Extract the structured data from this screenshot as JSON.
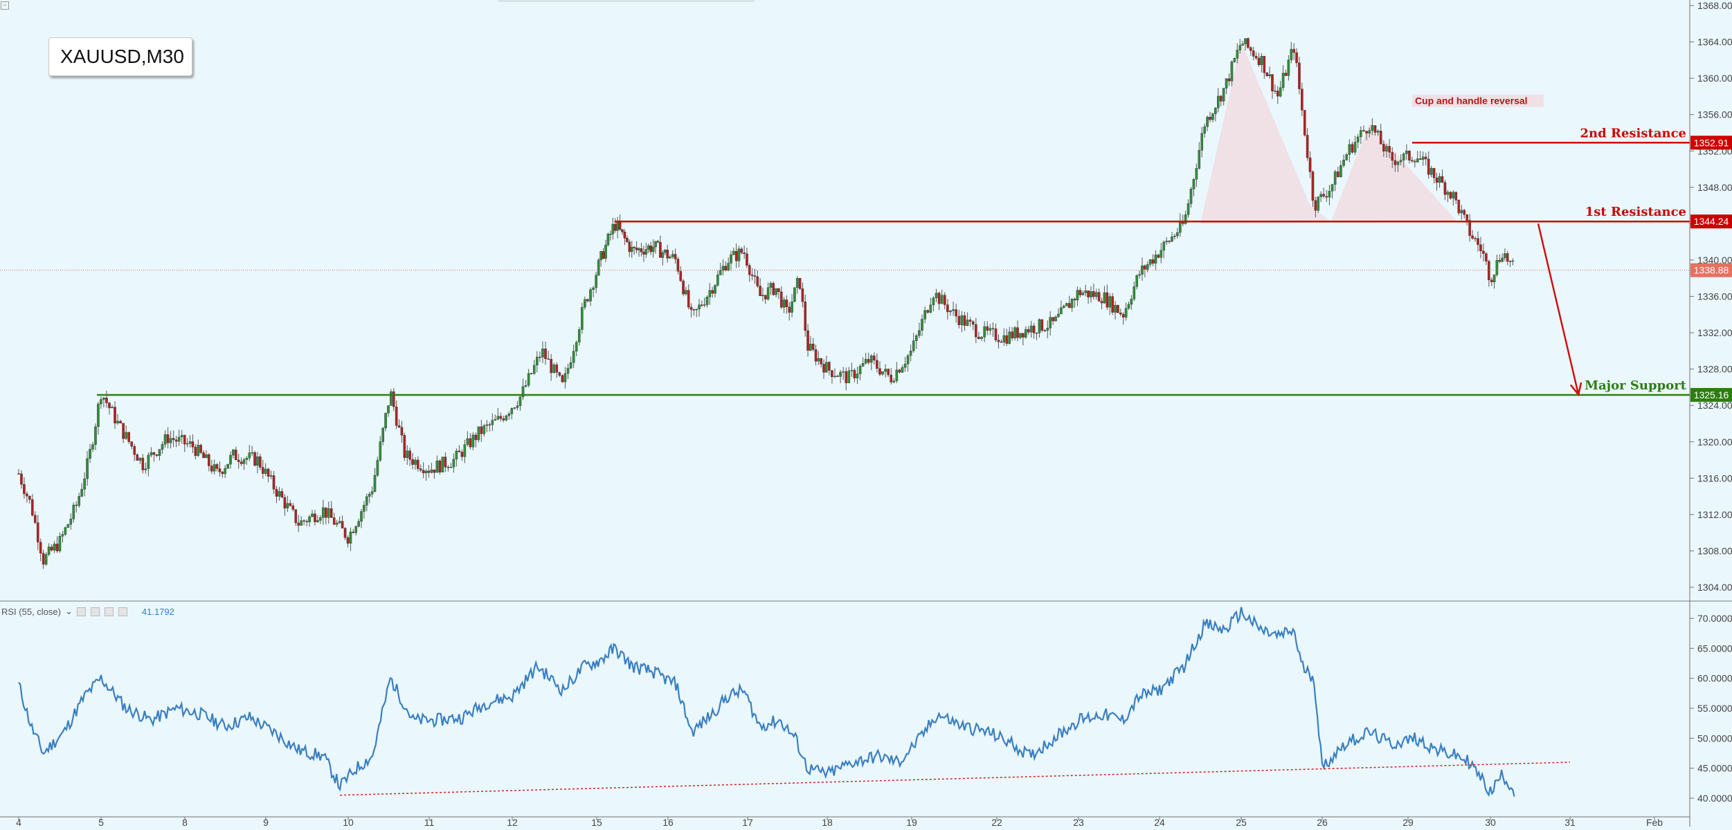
{
  "symbol": "XAUUSD,M30",
  "colors": {
    "background": "#eaf7fc",
    "bull": "#2f8f3a",
    "bear": "#b22222",
    "resistance": "#cc0000",
    "support": "#2e7d13",
    "rsi_line": "#3a7fc0",
    "pattern_fill": "#f1dde3"
  },
  "chart_data": [
    {
      "type": "candlestick",
      "symbol": "XAUUSD",
      "timeframe": "M30",
      "x_ticks": [
        "4",
        "5",
        "8",
        "9",
        "10",
        "11",
        "12",
        "15",
        "16",
        "17",
        "18",
        "19",
        "22",
        "23",
        "24",
        "25",
        "26",
        "29",
        "30",
        "31",
        "Feb"
      ],
      "ylim": [
        1302,
        1368
      ],
      "y_ticks": [
        1304,
        1308,
        1312,
        1316,
        1320,
        1324,
        1328,
        1332,
        1336,
        1340,
        1344,
        1348,
        1352,
        1356,
        1360,
        1364,
        1368
      ],
      "close_path": [
        {
          "x": 0,
          "y": 1316.5
        },
        {
          "x": 0.15,
          "y": 1313
        },
        {
          "x": 0.3,
          "y": 1307
        },
        {
          "x": 0.5,
          "y": 1309
        },
        {
          "x": 0.7,
          "y": 1313
        },
        {
          "x": 0.85,
          "y": 1318
        },
        {
          "x": 1.0,
          "y": 1325.5
        },
        {
          "x": 1.2,
          "y": 1322
        },
        {
          "x": 1.5,
          "y": 1317.5
        },
        {
          "x": 1.8,
          "y": 1320.5
        },
        {
          "x": 2.1,
          "y": 1319.5
        },
        {
          "x": 2.4,
          "y": 1316.5
        },
        {
          "x": 2.6,
          "y": 1318.5
        },
        {
          "x": 2.9,
          "y": 1318
        },
        {
          "x": 3.1,
          "y": 1315
        },
        {
          "x": 3.4,
          "y": 1311
        },
        {
          "x": 3.7,
          "y": 1312.5
        },
        {
          "x": 4.0,
          "y": 1309.5
        },
        {
          "x": 4.3,
          "y": 1315
        },
        {
          "x": 4.52,
          "y": 1325.5
        },
        {
          "x": 4.7,
          "y": 1318.5
        },
        {
          "x": 5.0,
          "y": 1317
        },
        {
          "x": 5.3,
          "y": 1318
        },
        {
          "x": 5.6,
          "y": 1321
        },
        {
          "x": 5.85,
          "y": 1322.5
        },
        {
          "x": 6.1,
          "y": 1325
        },
        {
          "x": 6.35,
          "y": 1330
        },
        {
          "x": 6.6,
          "y": 1326
        },
        {
          "x": 6.85,
          "y": 1335
        },
        {
          "x": 7.05,
          "y": 1340
        },
        {
          "x": 7.25,
          "y": 1344
        },
        {
          "x": 7.5,
          "y": 1341
        },
        {
          "x": 7.8,
          "y": 1341.5
        },
        {
          "x": 8.1,
          "y": 1340
        },
        {
          "x": 8.3,
          "y": 1333.5
        },
        {
          "x": 8.55,
          "y": 1337
        },
        {
          "x": 8.75,
          "y": 1340
        },
        {
          "x": 8.95,
          "y": 1341
        },
        {
          "x": 9.15,
          "y": 1336
        },
        {
          "x": 9.35,
          "y": 1337
        },
        {
          "x": 9.5,
          "y": 1334
        },
        {
          "x": 9.65,
          "y": 1338
        },
        {
          "x": 9.75,
          "y": 1330.5
        },
        {
          "x": 10.0,
          "y": 1328
        },
        {
          "x": 10.25,
          "y": 1327
        },
        {
          "x": 10.5,
          "y": 1329
        },
        {
          "x": 10.75,
          "y": 1327
        },
        {
          "x": 11.0,
          "y": 1330
        },
        {
          "x": 11.25,
          "y": 1336.5
        },
        {
          "x": 11.5,
          "y": 1334
        },
        {
          "x": 11.8,
          "y": 1332
        },
        {
          "x": 12.1,
          "y": 1331.5
        },
        {
          "x": 12.4,
          "y": 1332.5
        },
        {
          "x": 12.7,
          "y": 1333
        },
        {
          "x": 13.0,
          "y": 1336.5
        },
        {
          "x": 13.3,
          "y": 1336
        },
        {
          "x": 13.55,
          "y": 1334
        },
        {
          "x": 13.75,
          "y": 1338.5
        },
        {
          "x": 14.0,
          "y": 1341
        },
        {
          "x": 14.3,
          "y": 1344
        },
        {
          "x": 14.55,
          "y": 1355
        },
        {
          "x": 14.8,
          "y": 1359
        },
        {
          "x": 15.0,
          "y": 1364
        },
        {
          "x": 15.25,
          "y": 1362
        },
        {
          "x": 15.45,
          "y": 1358
        },
        {
          "x": 15.65,
          "y": 1363.5
        },
        {
          "x": 15.9,
          "y": 1346
        },
        {
          "x": 16.1,
          "y": 1348
        },
        {
          "x": 16.3,
          "y": 1352
        },
        {
          "x": 16.55,
          "y": 1355
        },
        {
          "x": 16.8,
          "y": 1351
        },
        {
          "x": 17.1,
          "y": 1351.5
        },
        {
          "x": 17.35,
          "y": 1349
        },
        {
          "x": 17.55,
          "y": 1347
        },
        {
          "x": 17.75,
          "y": 1343
        },
        {
          "x": 17.9,
          "y": 1341
        },
        {
          "x": 18.0,
          "y": 1338
        },
        {
          "x": 18.15,
          "y": 1341
        },
        {
          "x": 18.3,
          "y": 1338.88
        }
      ],
      "price_levels": [
        {
          "label": "2nd Resistance",
          "value": "1352.91",
          "role": "resistance"
        },
        {
          "label": "1st Resistance",
          "value": "1344.24",
          "role": "resistance"
        },
        {
          "label": "",
          "value": "1338.88",
          "role": "current"
        },
        {
          "label": "Major Support",
          "value": "1325.16",
          "role": "support"
        }
      ],
      "annotations": [
        "Cup and handle reversal"
      ],
      "forecast_arrow": {
        "from_x": 18.6,
        "from_y": 1344,
        "to_x": 19.1,
        "to_y": 1325.2
      }
    },
    {
      "type": "line",
      "indicator": "RSI (55, close)",
      "current_value": "41.1792",
      "ylim": [
        38.5,
        72.5
      ],
      "y_ticks": [
        "40.0000",
        "45.0000",
        "50.0000",
        "55.0000",
        "60.0000",
        "65.0000",
        "70.0000"
      ],
      "values": [
        {
          "x": 0,
          "y": 59
        },
        {
          "x": 0.15,
          "y": 52
        },
        {
          "x": 0.3,
          "y": 47.5
        },
        {
          "x": 0.55,
          "y": 51
        },
        {
          "x": 0.8,
          "y": 57
        },
        {
          "x": 1.0,
          "y": 60
        },
        {
          "x": 1.3,
          "y": 55
        },
        {
          "x": 1.6,
          "y": 53
        },
        {
          "x": 1.9,
          "y": 55
        },
        {
          "x": 2.2,
          "y": 54
        },
        {
          "x": 2.5,
          "y": 52
        },
        {
          "x": 2.8,
          "y": 53.5
        },
        {
          "x": 3.1,
          "y": 51
        },
        {
          "x": 3.4,
          "y": 48
        },
        {
          "x": 3.7,
          "y": 47
        },
        {
          "x": 3.9,
          "y": 42
        },
        {
          "x": 4.1,
          "y": 45
        },
        {
          "x": 4.3,
          "y": 47
        },
        {
          "x": 4.52,
          "y": 60
        },
        {
          "x": 4.8,
          "y": 53
        },
        {
          "x": 5.1,
          "y": 53
        },
        {
          "x": 5.4,
          "y": 53.5
        },
        {
          "x": 5.7,
          "y": 56
        },
        {
          "x": 6.0,
          "y": 57
        },
        {
          "x": 6.3,
          "y": 62
        },
        {
          "x": 6.6,
          "y": 58
        },
        {
          "x": 6.85,
          "y": 62
        },
        {
          "x": 7.05,
          "y": 63
        },
        {
          "x": 7.25,
          "y": 65
        },
        {
          "x": 7.5,
          "y": 62
        },
        {
          "x": 7.8,
          "y": 61
        },
        {
          "x": 8.1,
          "y": 59
        },
        {
          "x": 8.3,
          "y": 51
        },
        {
          "x": 8.55,
          "y": 54
        },
        {
          "x": 8.75,
          "y": 57
        },
        {
          "x": 8.95,
          "y": 58
        },
        {
          "x": 9.15,
          "y": 52
        },
        {
          "x": 9.4,
          "y": 53
        },
        {
          "x": 9.6,
          "y": 50
        },
        {
          "x": 9.75,
          "y": 45
        },
        {
          "x": 10.0,
          "y": 44
        },
        {
          "x": 10.3,
          "y": 46
        },
        {
          "x": 10.6,
          "y": 47
        },
        {
          "x": 10.85,
          "y": 46
        },
        {
          "x": 11.1,
          "y": 50
        },
        {
          "x": 11.3,
          "y": 54
        },
        {
          "x": 11.6,
          "y": 52
        },
        {
          "x": 11.9,
          "y": 51
        },
        {
          "x": 12.2,
          "y": 49
        },
        {
          "x": 12.4,
          "y": 47
        },
        {
          "x": 12.7,
          "y": 50
        },
        {
          "x": 13.0,
          "y": 53
        },
        {
          "x": 13.3,
          "y": 54
        },
        {
          "x": 13.55,
          "y": 53
        },
        {
          "x": 13.75,
          "y": 57
        },
        {
          "x": 14.0,
          "y": 58
        },
        {
          "x": 14.3,
          "y": 62
        },
        {
          "x": 14.55,
          "y": 69
        },
        {
          "x": 14.8,
          "y": 68
        },
        {
          "x": 15.0,
          "y": 71
        },
        {
          "x": 15.25,
          "y": 68
        },
        {
          "x": 15.45,
          "y": 67
        },
        {
          "x": 15.65,
          "y": 68
        },
        {
          "x": 15.75,
          "y": 62
        },
        {
          "x": 15.9,
          "y": 60
        },
        {
          "x": 16.0,
          "y": 45
        },
        {
          "x": 16.25,
          "y": 49
        },
        {
          "x": 16.55,
          "y": 51
        },
        {
          "x": 16.8,
          "y": 49
        },
        {
          "x": 17.1,
          "y": 50
        },
        {
          "x": 17.35,
          "y": 48
        },
        {
          "x": 17.6,
          "y": 47
        },
        {
          "x": 17.75,
          "y": 46
        },
        {
          "x": 17.9,
          "y": 43
        },
        {
          "x": 18.0,
          "y": 41
        },
        {
          "x": 18.15,
          "y": 44
        },
        {
          "x": 18.3,
          "y": 41.2
        }
      ],
      "trendline": {
        "from_x": 3.9,
        "from_y": 40.5,
        "to_x": 19.0,
        "to_y": 46
      }
    }
  ]
}
